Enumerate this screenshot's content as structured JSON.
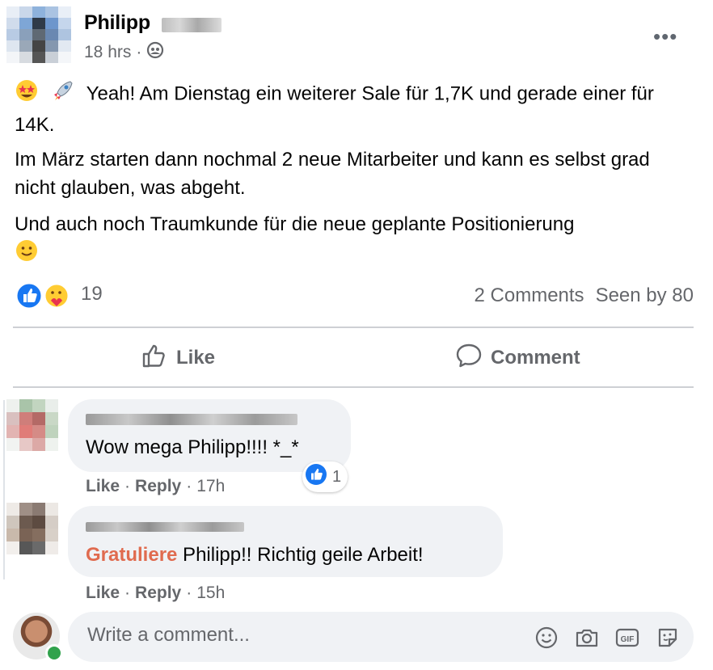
{
  "post": {
    "author": "Philipp",
    "time": "18 hrs",
    "separator": "·",
    "paragraphs": [
      "Yeah! Am Dienstag ein weiterer Sale für 1,7K und gerade einer für 14K.",
      "Im März starten dann nochmal 2 neue Mitarbeiter und kann es selbst grad nicht glauben, was abgeht.",
      "Und auch noch Traumkunde für die neue geplante Positionierung"
    ],
    "reaction_count": "19",
    "comments_count": "2 Comments",
    "seen_by": "Seen by 80"
  },
  "actions": {
    "like": "Like",
    "comment": "Comment"
  },
  "comments": [
    {
      "text": "Wow mega Philipp!!!! *_*",
      "like": "Like",
      "reply": "Reply",
      "time": "17h",
      "reaction_count": "1"
    },
    {
      "tag": "Gratuliere",
      "text": " Philipp!! Richtig geile Arbeit!",
      "like": "Like",
      "reply": "Reply",
      "time": "15h"
    }
  ],
  "composer": {
    "placeholder": "Write a comment..."
  },
  "colors": {
    "accent_blue": "#1877f2",
    "secondary_text": "#65676b",
    "bubble": "#f0f2f5",
    "tag": "#e06b4f",
    "online": "#31a24c"
  }
}
